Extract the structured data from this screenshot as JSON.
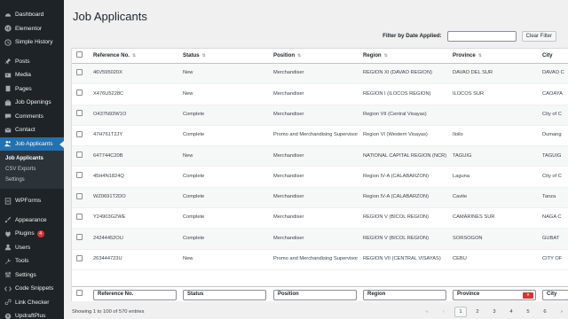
{
  "sidebar": {
    "items": [
      {
        "label": "Dashboard",
        "icon": "dashboard-icon"
      },
      {
        "label": "Elementor",
        "icon": "elementor-icon"
      },
      {
        "label": "Simple History",
        "icon": "history-icon"
      },
      {
        "label": "Posts",
        "icon": "pin-icon"
      },
      {
        "label": "Media",
        "icon": "media-icon"
      },
      {
        "label": "Pages",
        "icon": "pages-icon"
      },
      {
        "label": "Job Openings",
        "icon": "briefcase-icon"
      },
      {
        "label": "Comments",
        "icon": "comment-icon"
      },
      {
        "label": "Contact",
        "icon": "mail-icon"
      },
      {
        "label": "Job Applicants",
        "icon": "people-icon"
      }
    ],
    "submenu": [
      "Job Applicants",
      "CSV Exports",
      "Settings"
    ],
    "items2": [
      {
        "label": "WPForms",
        "icon": "wpforms-icon"
      },
      {
        "label": "Appearance",
        "icon": "brush-icon"
      },
      {
        "label": "Plugins",
        "icon": "plug-icon",
        "badge": "4"
      },
      {
        "label": "Users",
        "icon": "user-icon"
      },
      {
        "label": "Tools",
        "icon": "wrench-icon"
      },
      {
        "label": "Settings",
        "icon": "settings-icon"
      },
      {
        "label": "Code Snippets",
        "icon": "code-icon"
      },
      {
        "label": "Link Checker",
        "icon": "link-icon"
      },
      {
        "label": "UpdraftPlus",
        "icon": "updraft-icon"
      }
    ]
  },
  "page": {
    "title": "Job Applicants",
    "filter_label": "Filter by Date Applied:",
    "clear_filter": "Clear Filter"
  },
  "table": {
    "headers": [
      "Reference No.",
      "Status",
      "Position",
      "Region",
      "Province",
      "City"
    ],
    "rows": [
      [
        "46V595020X",
        "New",
        "Merchandiser",
        "REGION XI (DAVAO REGION)",
        "DAVAO DEL SUR",
        "DAVAO C"
      ],
      [
        "X476U5228C",
        "New",
        "Merchandiser",
        "REGION I (ILOCOS REGION)",
        "ILOCOS SUR",
        "CAOAYA"
      ],
      [
        "O437N93W1O",
        "Complete",
        "Merchandiser",
        "Region VII (Central Visayas)",
        "",
        "City of C"
      ],
      [
        "47H761T2JY",
        "Complete",
        "Promo and Merchandising Supervisor",
        "Region VI (Western Visayas)",
        "Iloilo",
        "Dumang"
      ],
      [
        "64T744C20B",
        "New",
        "Merchandiser",
        "NATIONAL CAPITAL REGION (NCR)",
        "TAGUIG",
        "TAGUIG"
      ],
      [
        "45H4N1824Q",
        "Complete",
        "Merchandiser",
        "Region IV-A (CALABARZON)",
        "Laguna",
        "City of C"
      ],
      [
        "WZ0691T2DO",
        "Complete",
        "Merchandiser",
        "Region IV-A (CALABARZON)",
        "Cavite",
        "Tanza"
      ],
      [
        "Y24903G2WE",
        "Complete",
        "Merchandiser",
        "REGION V (BICOL REGION)",
        "CAMARINES SUR",
        "NAGA C"
      ],
      [
        "24244452OU",
        "Complete",
        "Merchandiser",
        "REGION V (BICOL REGION)",
        "SORSOGON",
        "GUBAT"
      ],
      [
        "263444723U",
        "New",
        "Promo and Merchandising Supervisor",
        "REGION VII (CENTRAL VISAYAS)",
        "CEBU",
        "CITY OF"
      ]
    ],
    "footer_filters": [
      "Reference No.",
      "Status",
      "Position",
      "Region",
      "Province",
      "City"
    ],
    "clear_x": "×"
  },
  "pagination": {
    "info": "Showing 1 to 100 of 570 entries",
    "first": "«",
    "prev": "‹",
    "pages": [
      "1",
      "2",
      "3",
      "4",
      "5",
      "6"
    ],
    "next": "›"
  }
}
